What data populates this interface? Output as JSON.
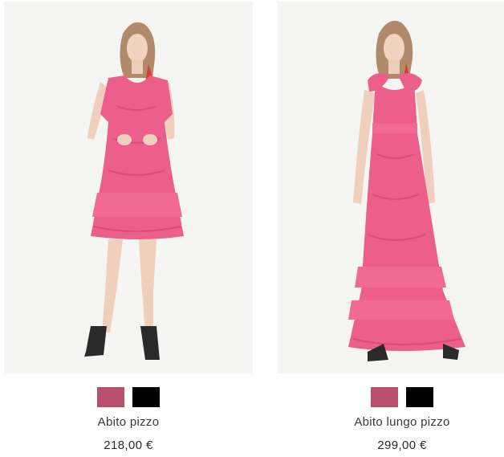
{
  "products": [
    {
      "name": "Abito pizzo",
      "price": "218,00 €",
      "image_alt": "model-short-pink-lace-dress",
      "swatches": [
        {
          "color": "#b94f6e",
          "name": "pink-swatch"
        },
        {
          "color": "#000000",
          "name": "black-swatch"
        }
      ]
    },
    {
      "name": "Abito lungo pizzo",
      "price": "299,00 €",
      "image_alt": "model-long-pink-lace-dress",
      "swatches": [
        {
          "color": "#b94f6e",
          "name": "pink-swatch"
        },
        {
          "color": "#000000",
          "name": "black-swatch"
        }
      ]
    }
  ],
  "colors": {
    "dress": "#ec5f8b",
    "dress_dark": "#d94c78",
    "background": "#f5f5f3"
  }
}
